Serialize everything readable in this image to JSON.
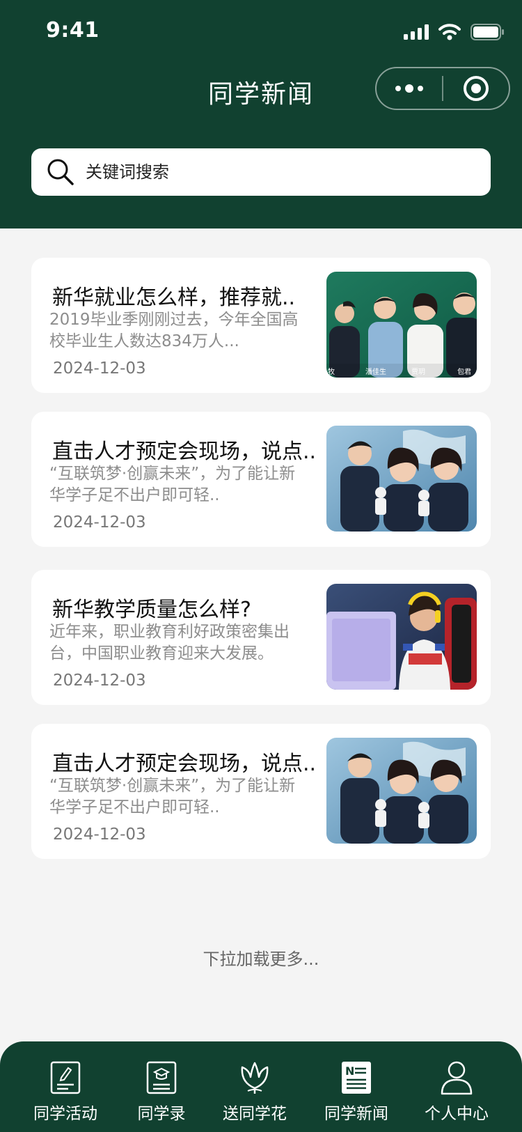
{
  "status": {
    "time": "9:41"
  },
  "navbar": {
    "title": "同学新闻"
  },
  "search": {
    "placeholder": "关键词搜索"
  },
  "news": [
    {
      "title": "新华就业怎么样，推荐就..",
      "desc": "2019毕业季刚刚过去，今年全国高校毕业生人数达834万人...",
      "date": "2024-12-03",
      "thumb_names": [
        "牧",
        "潘佳生",
        "贾玥",
        "包君"
      ]
    },
    {
      "title": "直击人才预定会现场，说点..",
      "desc": "“互联筑梦·创赢未来”，为了能让新华学子足不出户即可轻..",
      "date": "2024-12-03"
    },
    {
      "title": "新华教学质量怎么样?",
      "desc": "近年来，职业教育利好政策密集出台，中国职业教育迎来大发展。",
      "date": "2024-12-03"
    },
    {
      "title": "直击人才预定会现场，说点..",
      "desc": "“互联筑梦·创赢未来”，为了能让新华学子足不出户即可轻..",
      "date": "2024-12-03"
    }
  ],
  "load_more": "下拉加载更多...",
  "tabbar": {
    "items": [
      {
        "label": "同学活动",
        "icon": "activity-icon"
      },
      {
        "label": "同学录",
        "icon": "classbook-icon"
      },
      {
        "label": "送同学花",
        "icon": "flower-icon"
      },
      {
        "label": "同学新闻",
        "icon": "news-icon",
        "active": true
      },
      {
        "label": "个人中心",
        "icon": "user-icon"
      }
    ]
  },
  "colors": {
    "primary": "#114130",
    "background": "#f4f4f4",
    "card": "#ffffff",
    "desc_text": "#8d8d8d"
  }
}
